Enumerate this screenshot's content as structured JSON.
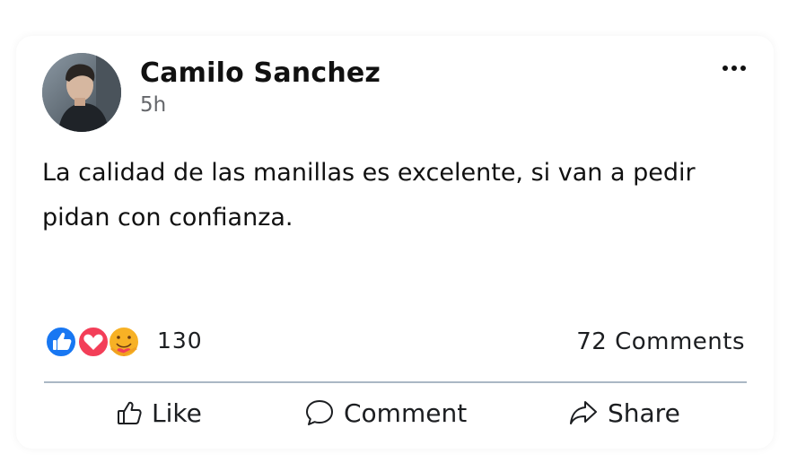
{
  "post": {
    "author": "Camilo Sanchez",
    "time": "5h",
    "text": "La calidad de las manillas es excelente, si van a pedir pidan con confianza.",
    "reactions": {
      "icons": [
        "like-icon",
        "love-icon",
        "care-icon"
      ],
      "count": "130"
    },
    "comments_count": "72 Comments"
  },
  "actions": {
    "like_label": "Like",
    "comment_label": "Comment",
    "share_label": "Share"
  },
  "colors": {
    "like_blue": "#1877f2",
    "love_red": "#f33e58",
    "care_yellow": "#f7b125",
    "divider": "#aab7c4",
    "secondary_text": "#65676b"
  }
}
